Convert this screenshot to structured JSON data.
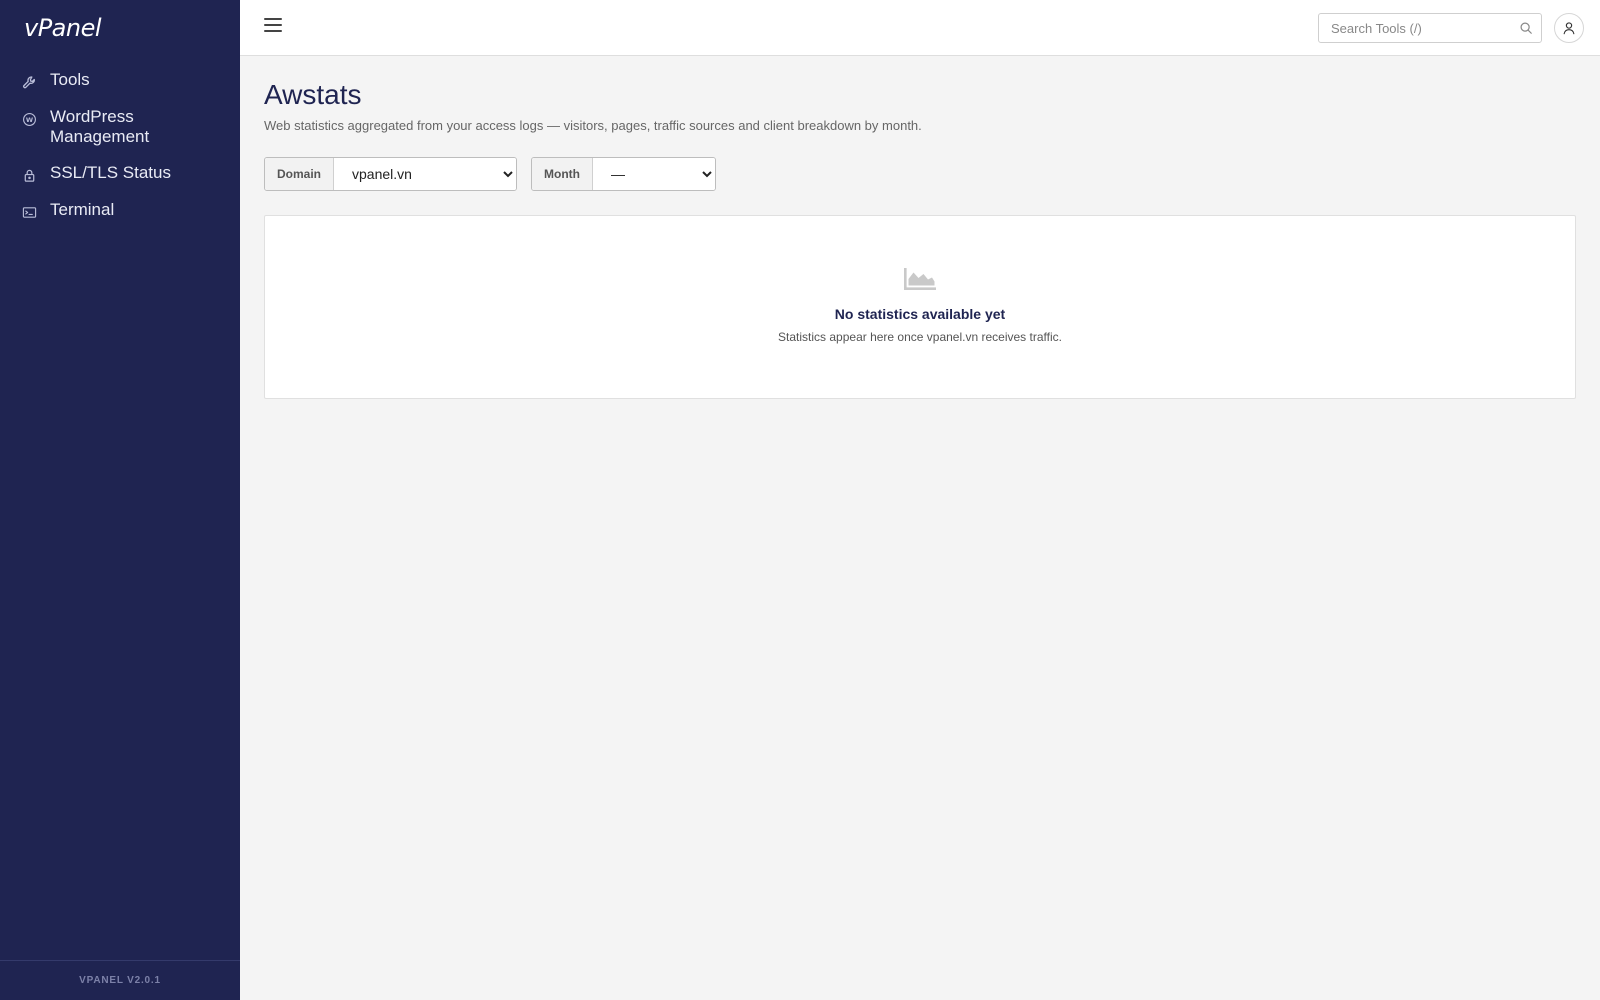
{
  "app": {
    "logo": "vPanel",
    "version": "VPANEL V2.0.1"
  },
  "sidebar": {
    "items": [
      {
        "label": "Tools",
        "icon": "wrench-icon"
      },
      {
        "label": "WordPress Management",
        "icon": "wordpress-icon"
      },
      {
        "label": "SSL/TLS Status",
        "icon": "lock-icon"
      },
      {
        "label": "Terminal",
        "icon": "terminal-icon"
      }
    ]
  },
  "header": {
    "search_placeholder": "Search Tools (/)",
    "icons": [
      "menu-icon",
      "search-icon",
      "user-icon"
    ]
  },
  "page": {
    "title": "Awstats",
    "description": "Web statistics aggregated from your access logs — visitors, pages, traffic sources and client breakdown by month."
  },
  "filters": {
    "domain": {
      "label": "Domain",
      "selected": "vpanel.vn"
    },
    "month": {
      "label": "Month",
      "selected": "—"
    }
  },
  "empty_state": {
    "icon": "area-chart-icon",
    "title": "No statistics available yet",
    "text": "Statistics appear here once vpanel.vn receives traffic."
  },
  "colors": {
    "sidebar": "#1f2451",
    "accent": "#1f2451",
    "background": "#f4f4f4"
  }
}
